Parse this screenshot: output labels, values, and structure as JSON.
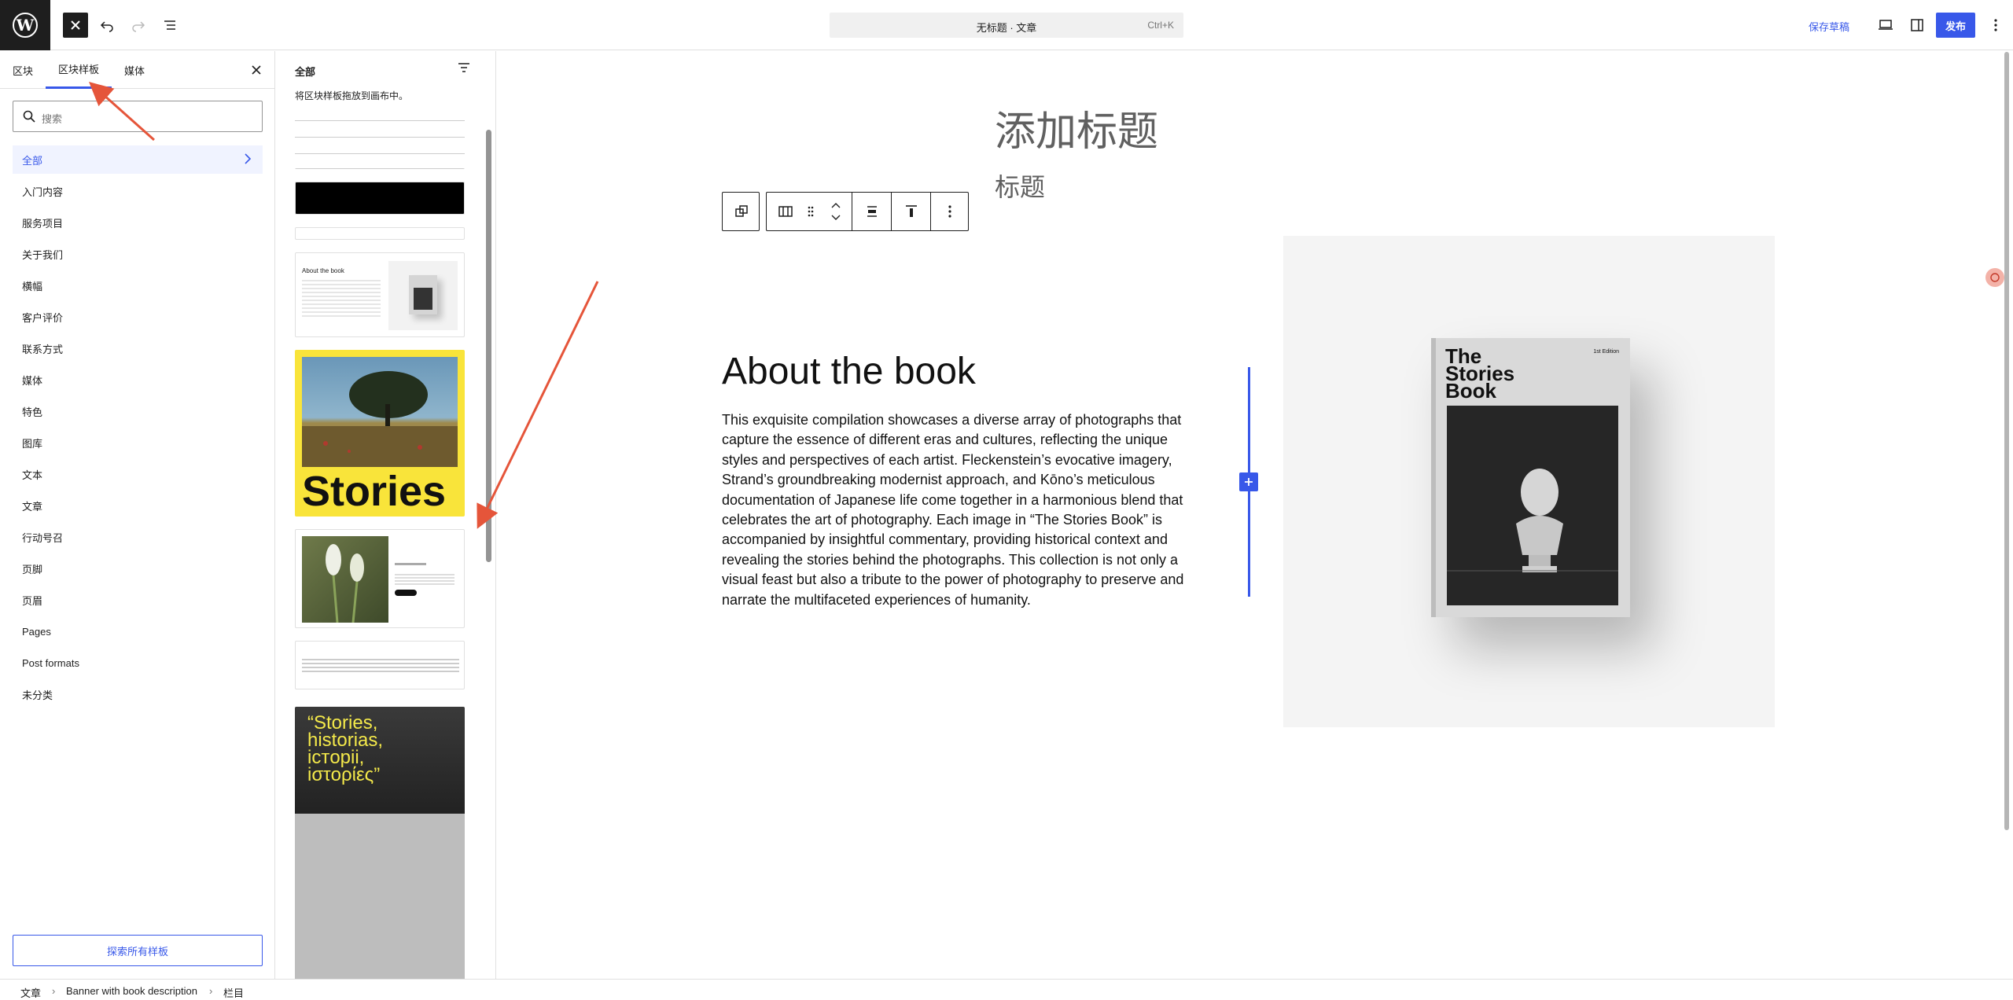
{
  "topbar": {
    "doc_title": "无标题 · 文章",
    "shortcut": "Ctrl+K",
    "save_draft": "保存草稿",
    "publish": "发布"
  },
  "inserter": {
    "tabs": [
      {
        "label": "区块"
      },
      {
        "label": "区块样板"
      },
      {
        "label": "媒体"
      }
    ],
    "search_placeholder": "搜索",
    "categories": [
      "全部",
      "入门内容",
      "服务项目",
      "关于我们",
      "横幅",
      "客户评价",
      "联系方式",
      "媒体",
      "特色",
      "图库",
      "文本",
      "文章",
      "行动号召",
      "页脚",
      "页眉",
      "Pages",
      "Post formats",
      "未分类"
    ],
    "explore_button": "探索所有样板"
  },
  "patterns": {
    "heading": "全部",
    "hint": "将区块样板拖放到画布中。",
    "card_about_title": "About the book",
    "card_stories_word": "Stories",
    "card_quote": "“Stories, historias, iстopii, iστoρίες”"
  },
  "editor": {
    "title_placeholder": "添加标题",
    "heading": "标题",
    "about_heading": "About the book",
    "about_paragraph": "This exquisite compilation showcases a diverse array of photographs that capture the essence of different eras and cultures, reflecting the unique styles and perspectives of each artist. Fleckenstein’s evocative imagery, Strand’s groundbreaking modernist approach, and Kōno’s meticulous documentation of Japanese life come together in a harmonious blend that celebrates the art of photography. Each image in “The Stories Book” is accompanied by insightful commentary, providing historical context and revealing the stories behind the photographs. This collection is not only a visual feast but also a tribute to the power of photography to preserve and narrate the multifaceted experiences of humanity.",
    "book_title": "The Stories Book",
    "book_edition": "1st Edition"
  },
  "breadcrumb": [
    "文章",
    "Banner with book description",
    "栏目"
  ],
  "colors": {
    "accent": "#3858e9",
    "annotation": "#e5553a",
    "dark": "#1e1e1e"
  }
}
